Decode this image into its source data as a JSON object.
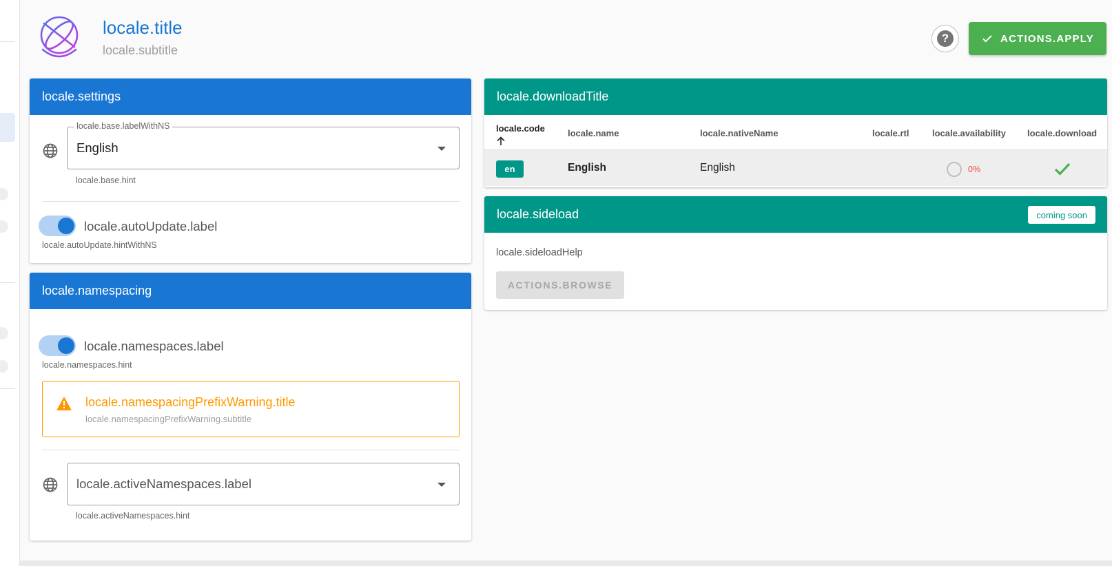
{
  "header": {
    "title": "locale.title",
    "subtitle": "locale.subtitle",
    "help_icon": "help-circle-icon",
    "apply_label": "ACTIONS.APPLY",
    "apply_color": "#4caf50"
  },
  "settings": {
    "title": "locale.settings",
    "base_legend": "locale.base.labelWithNS",
    "base_value": "English",
    "base_hint": "locale.base.hint",
    "auto_update_label": "locale.autoUpdate.label",
    "auto_update_hint": "locale.autoUpdate.hintWithNS",
    "auto_update_on": true
  },
  "namespacing": {
    "title": "locale.namespacing",
    "namespaces_label": "locale.namespaces.label",
    "namespaces_hint": "locale.namespaces.hint",
    "namespaces_on": true,
    "warning_title": "locale.namespacingPrefixWarning.title",
    "warning_subtitle": "locale.namespacingPrefixWarning.subtitle",
    "active_label": "locale.activeNamespaces.label",
    "active_hint": "locale.activeNamespaces.hint"
  },
  "download": {
    "title": "locale.downloadTitle",
    "columns": {
      "code": "locale.code",
      "name": "locale.name",
      "native": "locale.nativeName",
      "rtl": "locale.rtl",
      "availability": "locale.availability",
      "download": "locale.download"
    },
    "rows": [
      {
        "code": "en",
        "name": "English",
        "native": "English",
        "availability": "0%",
        "downloaded": true
      }
    ]
  },
  "sideload": {
    "title": "locale.sideload",
    "badge": "coming soon",
    "help": "locale.sideloadHelp",
    "browse_label": "ACTIONS.BROWSE"
  },
  "colors": {
    "primary": "#1976d2",
    "teal": "#009688",
    "warning": "#ff9800",
    "error": "#f44336"
  }
}
